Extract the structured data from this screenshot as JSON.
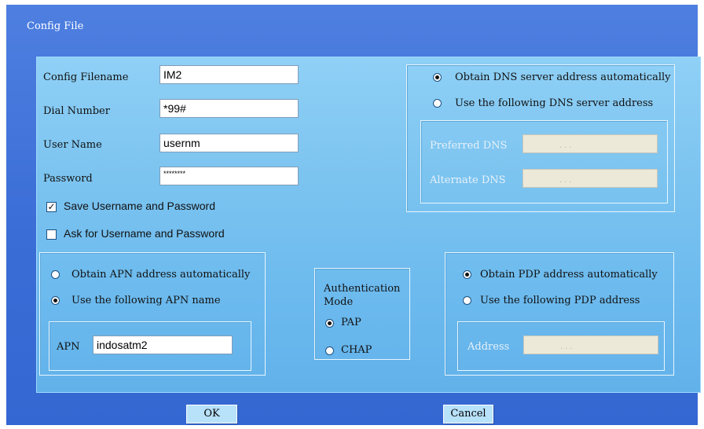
{
  "window": {
    "title": "Config File"
  },
  "profile": {
    "config_filename_label": "Config Filename",
    "config_filename_value": "IM2",
    "dial_number_label": "Dial Number",
    "dial_number_value": "*99#",
    "user_name_label": "User Name",
    "user_name_value": "usernm",
    "password_label": "Password",
    "password_value": "********",
    "save_credentials_label": "Save Username and Password",
    "save_credentials_checked": true,
    "ask_credentials_label": "Ask for Username and Password",
    "ask_credentials_checked": false
  },
  "dns": {
    "auto_label": "Obtain DNS server address automatically",
    "manual_label": "Use the following DNS server address",
    "selected": "auto",
    "preferred_label": "Preferred DNS",
    "alternate_label": "Alternate DNS",
    "ip_dots": ".     .     ."
  },
  "apn": {
    "auto_label": "Obtain APN address automatically",
    "manual_label": "Use the following APN name",
    "selected": "manual",
    "apn_label": "APN",
    "apn_value": "indosatm2"
  },
  "auth": {
    "label_line1": "Authentication",
    "label_line2": "Mode",
    "pap_label": "PAP",
    "chap_label": "CHAP",
    "selected": "PAP"
  },
  "pdp": {
    "auto_label": "Obtain PDP address automatically",
    "manual_label": "Use the following PDP address",
    "selected": "auto",
    "address_label": "Address",
    "ip_dots": ".     .     ."
  },
  "buttons": {
    "ok": "OK",
    "cancel": "Cancel"
  },
  "colors": {
    "dialog_bg": "#3a6dd6",
    "panel_bg": "#7cc4f0",
    "button_bg": "#b8e1fa"
  }
}
